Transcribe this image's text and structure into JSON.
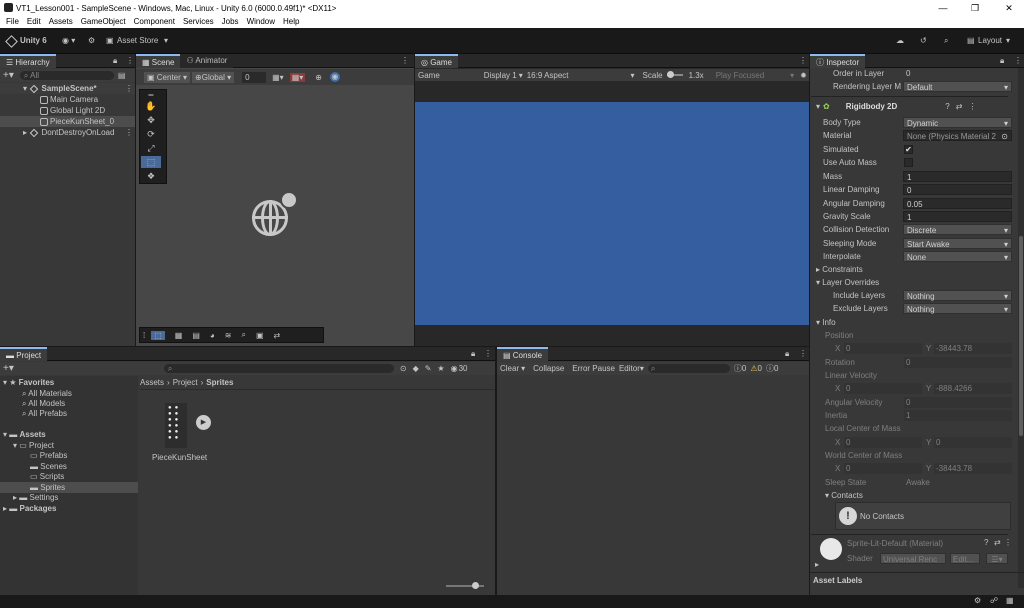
{
  "window": {
    "title": "VT1_Lesson001 - SampleScene - Windows, Mac, Linux - Unity 6.0 (6000.0.49f1)* <DX11>",
    "min": "—",
    "max": "❐",
    "close": "✕"
  },
  "menu": [
    "File",
    "Edit",
    "Assets",
    "GameObject",
    "Component",
    "Services",
    "Jobs",
    "Window",
    "Help"
  ],
  "toolbar": {
    "unity": "Unity 6",
    "asset_store": "Asset Store",
    "layout": "Layout"
  },
  "hierarchy": {
    "tab": "Hierarchy",
    "search_placeholder": "All",
    "scene": "SampleScene*",
    "items": [
      "Main Camera",
      "Global Light 2D",
      "PieceKunSheet_0"
    ],
    "dontdestroy": "DontDestroyOnLoad"
  },
  "scene": {
    "tab": "Scene",
    "tab2": "Animator",
    "center": "Center",
    "global": "Global",
    "snap": "0"
  },
  "game": {
    "tab": "Game",
    "mode": "Game",
    "display": "Display 1",
    "aspect": "16:9 Aspect",
    "scale_label": "Scale",
    "scale": "1.3x",
    "play_focused": "Play Focused",
    "bg": "#345e9f"
  },
  "project": {
    "tab": "Project",
    "count": "30",
    "favorites": "Favorites",
    "fav_items": [
      "All Materials",
      "All Models",
      "All Prefabs"
    ],
    "assets": "Assets",
    "project": "Project",
    "folders": [
      "Prefabs",
      "Scenes",
      "Scripts",
      "Sprites"
    ],
    "settings": "Settings",
    "packages": "Packages",
    "breadcrumb": [
      "Assets",
      "Project",
      "Sprites"
    ],
    "asset_name": "PieceKunSheet"
  },
  "console": {
    "tab": "Console",
    "clear": "Clear",
    "collapse": "Collapse",
    "error_pause": "Error Pause",
    "editor": "Editor",
    "c1": "0",
    "c2": "0",
    "c3": "0"
  },
  "inspector": {
    "tab": "Inspector",
    "order_label": "Order in Layer",
    "order_value": "0",
    "rendering_label": "Rendering Layer M",
    "rendering_value": "Default",
    "component": "Rigidbody 2D",
    "fields": [
      {
        "label": "Body Type",
        "value": "Dynamic",
        "kind": "drop"
      },
      {
        "label": "Material",
        "value": "None (Physics Material 2",
        "kind": "obj"
      },
      {
        "label": "Simulated",
        "value": "✔",
        "kind": "check"
      },
      {
        "label": "Use Auto Mass",
        "value": "",
        "kind": "check"
      },
      {
        "label": "Mass",
        "value": "1",
        "kind": "text"
      },
      {
        "label": "Linear Damping",
        "value": "0",
        "kind": "text"
      },
      {
        "label": "Angular Damping",
        "value": "0.05",
        "kind": "text"
      },
      {
        "label": "Gravity Scale",
        "value": "1",
        "kind": "text"
      },
      {
        "label": "Collision Detection",
        "value": "Discrete",
        "kind": "drop"
      },
      {
        "label": "Sleeping Mode",
        "value": "Start Awake",
        "kind": "drop"
      },
      {
        "label": "Interpolate",
        "value": "None",
        "kind": "drop"
      }
    ],
    "constraints": "Constraints",
    "layer_overrides": "Layer Overrides",
    "include_layers": "Include Layers",
    "include_value": "Nothing",
    "exclude_layers": "Exclude Layers",
    "exclude_value": "Nothing",
    "info": "Info",
    "position": "Position",
    "pos_x": "0",
    "pos_y": "-38443.78",
    "rotation": "Rotation",
    "rotation_value": "0",
    "linear_velocity": "Linear Velocity",
    "lv_x": "0",
    "lv_y": "-888.4266",
    "angular_velocity": "Angular Velocity",
    "av_value": "0",
    "inertia": "Inertia",
    "inertia_value": "1",
    "local_com": "Local Center of Mass",
    "lcom_x": "0",
    "lcom_y": "0",
    "world_com": "World Center of Mass",
    "wcom_x": "0",
    "wcom_y": "-38443.78",
    "sleep_state": "Sleep State",
    "sleep_value": "Awake",
    "contacts": "Contacts",
    "no_contacts": "No Contacts",
    "material_name": "Sprite-Lit-Default (Material)",
    "shader_label": "Shader",
    "shader_value": "Universal Renc",
    "edit": "Edit...",
    "asset_labels": "Asset Labels",
    "x": "X",
    "y": "Y"
  }
}
